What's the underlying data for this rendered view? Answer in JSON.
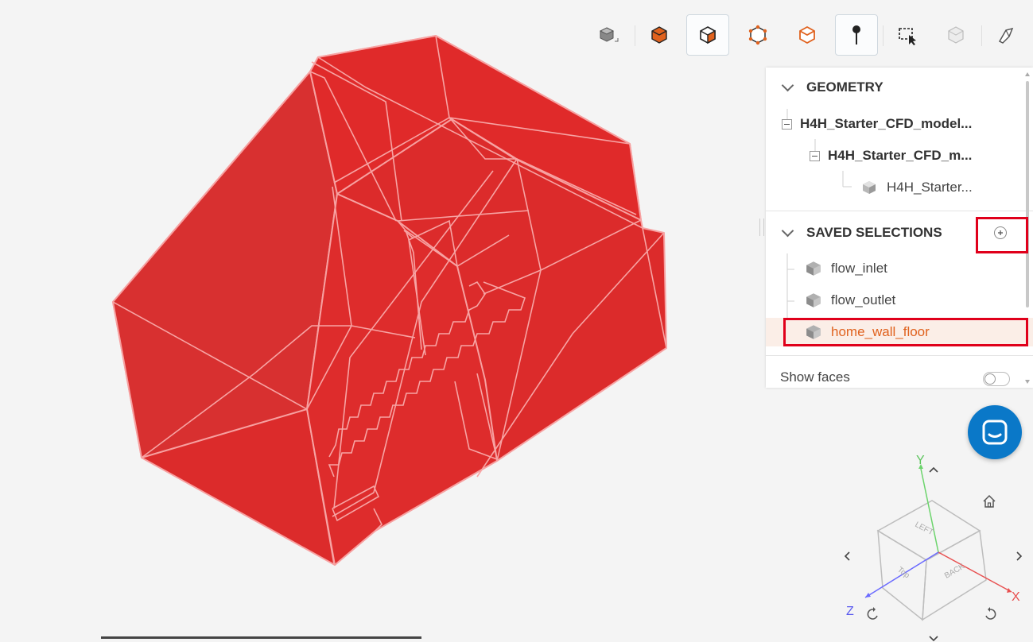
{
  "toolbar": {
    "buttons": [
      {
        "name": "view-cube-icon",
        "active": false
      },
      {
        "name": "solid-view-icon",
        "active": false
      },
      {
        "name": "select-solid-icon",
        "active": true
      },
      {
        "name": "select-vertex-icon",
        "active": false
      },
      {
        "name": "select-edge-icon",
        "active": false
      },
      {
        "name": "point-pin-icon",
        "active": true
      },
      {
        "name": "box-select-icon",
        "active": false
      },
      {
        "name": "mesh-icon",
        "active": false
      },
      {
        "name": "clipping-icon",
        "active": false
      }
    ]
  },
  "panel": {
    "geometry": {
      "title": "GEOMETRY",
      "tree": [
        {
          "label": "H4H_Starter_CFD_model...",
          "level": 0
        },
        {
          "label": "H4H_Starter_CFD_m...",
          "level": 1
        },
        {
          "label": "H4H_Starter...",
          "level": 2
        }
      ]
    },
    "saved_selections": {
      "title": "SAVED SELECTIONS",
      "items": [
        {
          "label": "flow_inlet",
          "active": false
        },
        {
          "label": "flow_outlet",
          "active": false
        },
        {
          "label": "home_wall_floor",
          "active": true
        }
      ]
    },
    "show_faces": {
      "label": "Show faces",
      "on": false
    }
  },
  "navcube": {
    "faces": {
      "left": "LEFT",
      "top": "Top",
      "back": "BACK"
    },
    "axes": {
      "x": "X",
      "y": "Y",
      "z": "Z"
    }
  },
  "colors": {
    "model": "#e02020",
    "accent": "#e0621e",
    "highlight_box": "#e0001b",
    "chat": "#0a78c8"
  }
}
